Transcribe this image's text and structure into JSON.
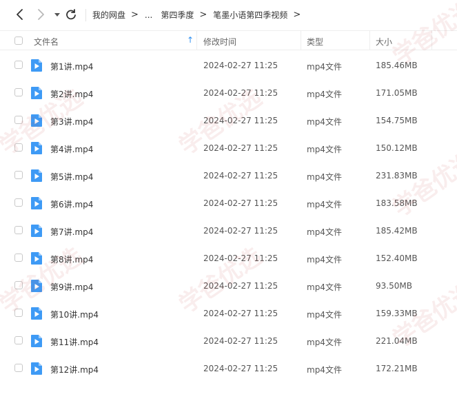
{
  "toolbar": {
    "back_icon": "chevron-left-icon",
    "forward_icon": "chevron-right-icon",
    "dropdown_icon": "caret-down-icon",
    "refresh_icon": "refresh-icon",
    "breadcrumb": [
      "我的网盘",
      "...",
      "第四季度",
      "笔墨小语第四季视频"
    ],
    "separator": ">"
  },
  "table": {
    "columns": {
      "name": "文件名",
      "modified": "修改时间",
      "type": "类型",
      "size": "大小"
    },
    "sort_indicator": "↑",
    "accent_color": "#2e8ef0",
    "rows": [
      {
        "name": "第1讲.mp4",
        "modified": "2024-02-27 11:25",
        "type": "mp4文件",
        "size": "185.46MB"
      },
      {
        "name": "第2讲.mp4",
        "modified": "2024-02-27 11:25",
        "type": "mp4文件",
        "size": "171.05MB"
      },
      {
        "name": "第3讲.mp4",
        "modified": "2024-02-27 11:25",
        "type": "mp4文件",
        "size": "154.75MB"
      },
      {
        "name": "第4讲.mp4",
        "modified": "2024-02-27 11:25",
        "type": "mp4文件",
        "size": "150.12MB"
      },
      {
        "name": "第5讲.mp4",
        "modified": "2024-02-27 11:25",
        "type": "mp4文件",
        "size": "231.83MB"
      },
      {
        "name": "第6讲.mp4",
        "modified": "2024-02-27 11:25",
        "type": "mp4文件",
        "size": "183.58MB"
      },
      {
        "name": "第7讲.mp4",
        "modified": "2024-02-27 11:25",
        "type": "mp4文件",
        "size": "185.42MB"
      },
      {
        "name": "第8讲.mp4",
        "modified": "2024-02-27 11:25",
        "type": "mp4文件",
        "size": "152.40MB"
      },
      {
        "name": "第9讲.mp4",
        "modified": "2024-02-27 11:25",
        "type": "mp4文件",
        "size": "93.50MB"
      },
      {
        "name": "第10讲.mp4",
        "modified": "2024-02-27 11:25",
        "type": "mp4文件",
        "size": "159.33MB"
      },
      {
        "name": "第11讲.mp4",
        "modified": "2024-02-27 11:25",
        "type": "mp4文件",
        "size": "221.04MB"
      },
      {
        "name": "第12讲.mp4",
        "modified": "2024-02-27 11:25",
        "type": "mp4文件",
        "size": "172.21MB"
      }
    ]
  },
  "watermark": {
    "text": "学爸优选"
  }
}
